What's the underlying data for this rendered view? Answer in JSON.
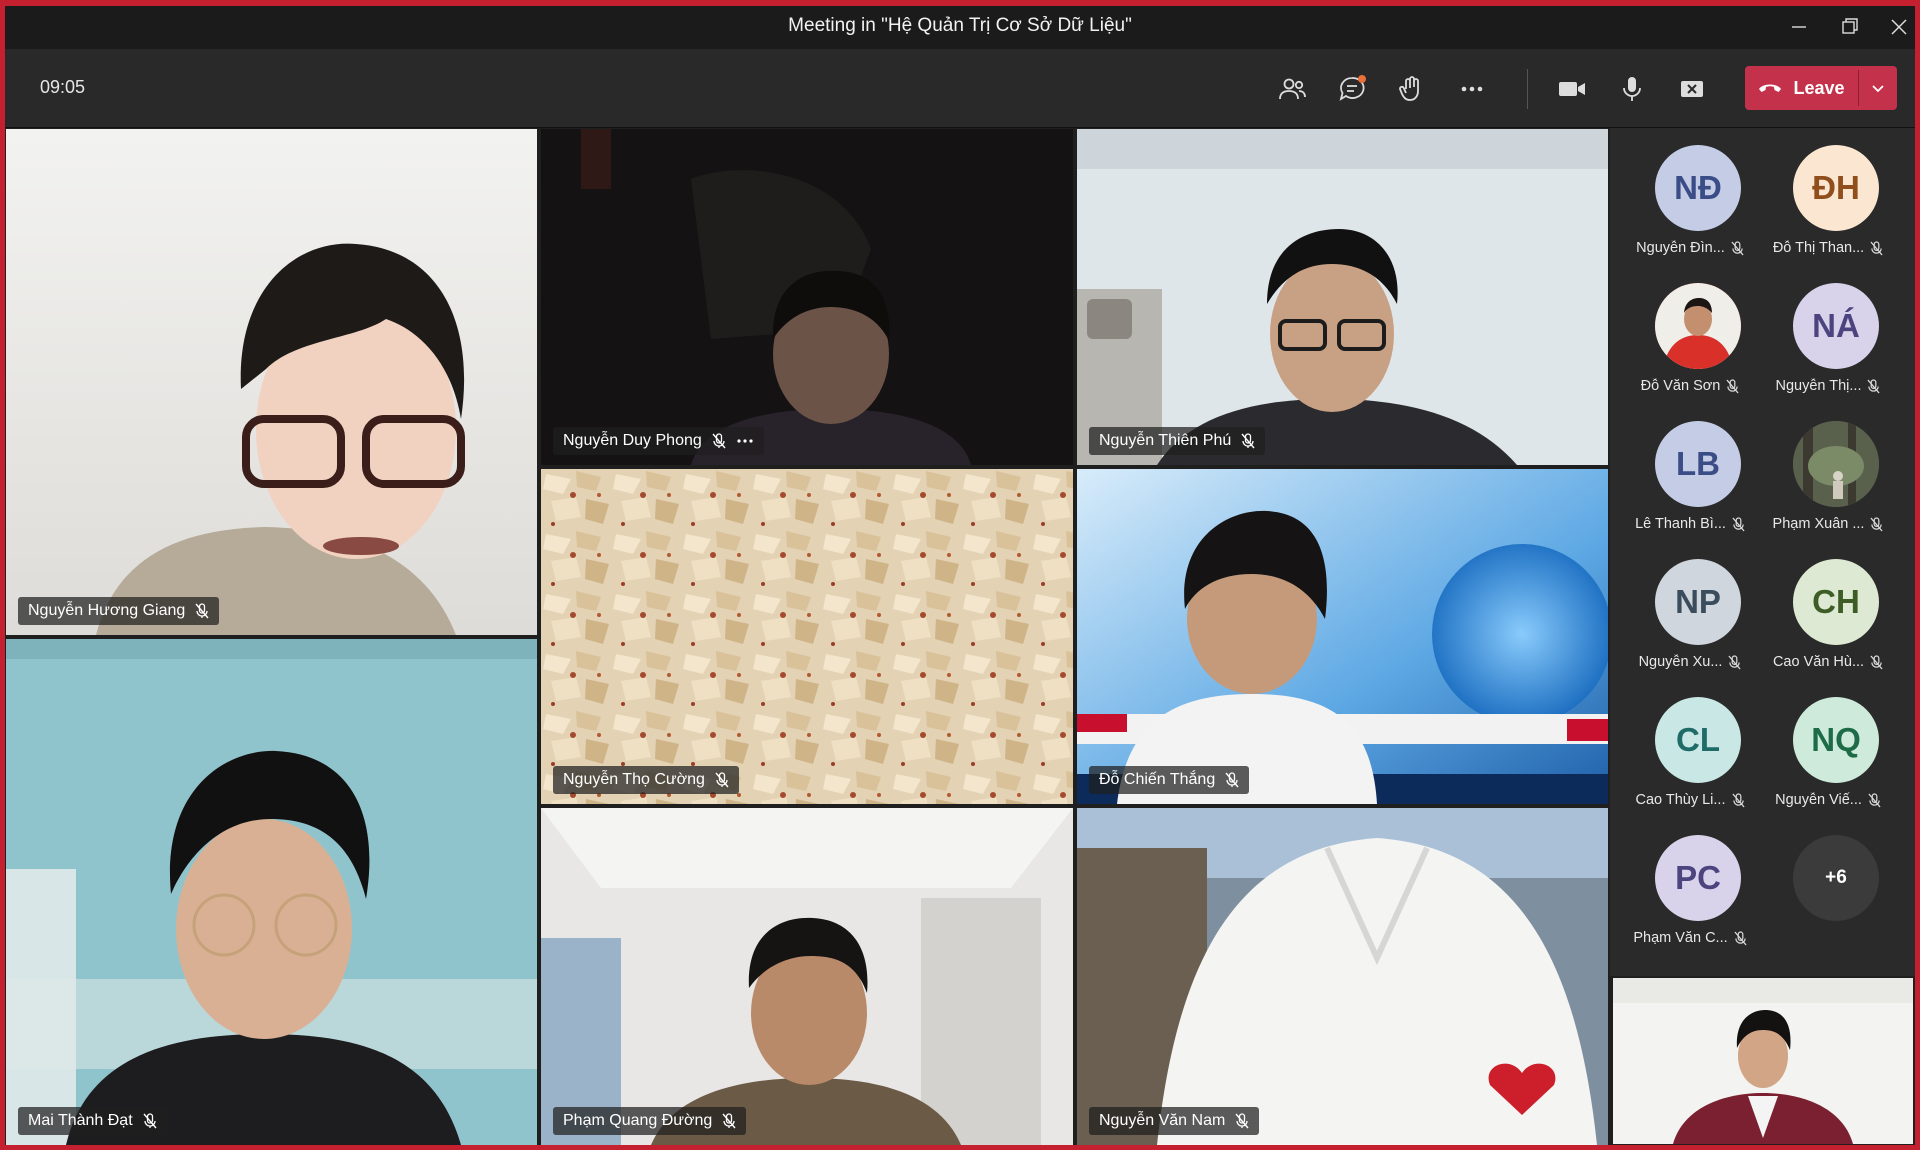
{
  "window": {
    "title": "Meeting in \"Hệ Quản Trị Cơ Sở Dữ Liệu\""
  },
  "toolbar": {
    "timer": "09:05",
    "leave_label": "Leave",
    "icons": [
      "people-icon",
      "chat-icon",
      "raise-hand-icon",
      "more-icon",
      "camera-icon",
      "microphone-icon",
      "share-screen-icon",
      "phone-hangup-icon",
      "chevron-down-icon"
    ]
  },
  "tiles": [
    {
      "name": "Nguyễn Hương Giang",
      "muted": true
    },
    {
      "name": "Nguyễn Duy Phong",
      "muted": true,
      "more": true
    },
    {
      "name": "Nguyễn Thiên Phú",
      "muted": true
    },
    {
      "name": "Nguyễn Thọ Cường",
      "muted": true
    },
    {
      "name": "Đỗ Chiến Thắng",
      "muted": true
    },
    {
      "name": "Mai Thành Đạt",
      "muted": true
    },
    {
      "name": "Phạm Quang Đường",
      "muted": true
    },
    {
      "name": "Nguyễn Văn Nam",
      "muted": true
    }
  ],
  "roster": [
    {
      "initials": "NĐ",
      "name": "Nguyễn Đìn...",
      "bg": "#c5cde6",
      "fg": "#3a4d86"
    },
    {
      "initials": "ĐH",
      "name": "Đỗ Thị Than...",
      "bg": "#fbe6d2",
      "fg": "#8f4e1b"
    },
    {
      "initials": "",
      "name": "Đỗ Văn Sơn",
      "bg": "#d23a2d",
      "fg": "#ffffff",
      "photo": true
    },
    {
      "initials": "NÁ",
      "name": "Nguyễn Thị...",
      "bg": "#d8d3ea",
      "fg": "#4c447f"
    },
    {
      "initials": "LB",
      "name": "Lê Thanh Bì...",
      "bg": "#c5cde6",
      "fg": "#3a4d86"
    },
    {
      "initials": "",
      "name": "Phạm Xuân ...",
      "bg": "#5f6b55",
      "fg": "#ffffff",
      "photo": true
    },
    {
      "initials": "NP",
      "name": "Nguyễn Xu...",
      "bg": "#cfd6dd",
      "fg": "#3b4d5c"
    },
    {
      "initials": "CH",
      "name": "Cao Văn Hù...",
      "bg": "#dde9d2",
      "fg": "#3e5d26"
    },
    {
      "initials": "CL",
      "name": "Cao Thùy Li...",
      "bg": "#c9e7e5",
      "fg": "#1e6b67"
    },
    {
      "initials": "NQ",
      "name": "Nguyễn Viế...",
      "bg": "#cdeadb",
      "fg": "#1e6b48"
    },
    {
      "initials": "PC",
      "name": "Phạm Văn C...",
      "bg": "#d8d3ea",
      "fg": "#4c447f"
    },
    {
      "initials": "+6",
      "name": "",
      "bg": "#3b3b3b",
      "fg": "#ffffff",
      "overflow": true
    }
  ]
}
